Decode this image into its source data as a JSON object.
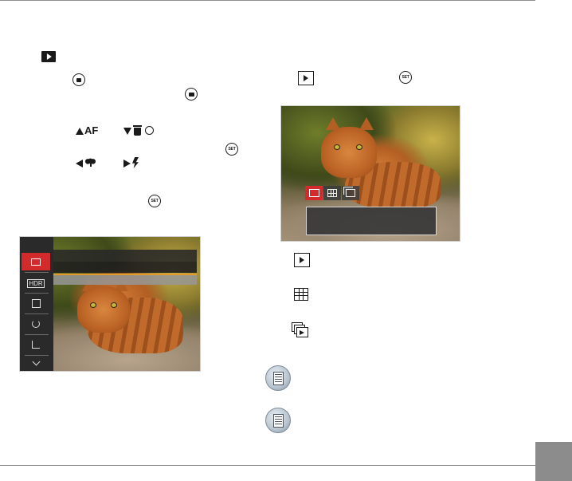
{
  "keys": {
    "up_label": "AF",
    "set_label": "SET",
    "hdr_label": "HDR"
  },
  "colors": {
    "menu_selected": "#d32b2b",
    "page_tab": "#8c8c8c",
    "rule": "#8e8e8e"
  },
  "icons": {
    "left_column": [
      "play-icon-filled",
      "playback-button-icon",
      "menu-button-icon",
      "up-af-icon",
      "down-delete-selftimer-icon",
      "set-button-icon",
      "left-macro-icon",
      "right-flash-icon",
      "set-button-icon"
    ],
    "right_column": [
      "play-outline-icon",
      "set-button-icon",
      "play-outline-icon",
      "thumbnail-grid-icon",
      "slideshow-icon",
      "note-icon",
      "note-icon"
    ],
    "left_menu": [
      "play-icon",
      "hdr-icon",
      "retouch-icon",
      "rotate-icon",
      "crop-icon",
      "chevron-down-icon"
    ]
  }
}
